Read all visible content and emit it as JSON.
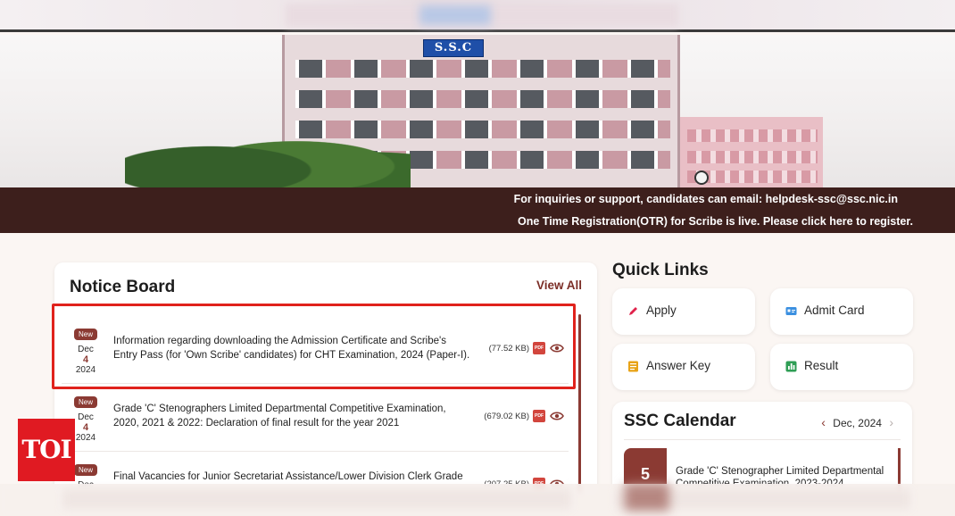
{
  "hero": {
    "building_sign": "S.S.C"
  },
  "info_banner": {
    "line1": "For inquiries or support, candidates can email: helpdesk-ssc@ssc.nic.in",
    "line2": "One Time Registration(OTR) for Scribe is live. Please click here to register."
  },
  "notice_board": {
    "title": "Notice Board",
    "view_all": "View All",
    "items": [
      {
        "badge": "New",
        "month": "Dec",
        "day": "4",
        "year": "2024",
        "text": "Information regarding downloading the Admission Certificate and Scribe's Entry Pass (for 'Own Scribe' candidates) for CHT Examination, 2024 (Paper-I).",
        "size": "(77.52 KB)",
        "pdf_label": "PDF",
        "highlighted": true
      },
      {
        "badge": "New",
        "month": "Dec",
        "day": "4",
        "year": "2024",
        "text": "Grade 'C' Stenographers Limited Departmental Competitive Examination, 2020, 2021 & 2022: Declaration of final result for the year 2021",
        "size": "(679.02 KB)",
        "pdf_label": "PDF",
        "highlighted": false
      },
      {
        "badge": "New",
        "month": "Dec",
        "day": "",
        "year": "",
        "text": "Final Vacancies for Junior Secretariat Assistance/Lower Division Clerk Grade",
        "size": "(207.25 KB)",
        "pdf_label": "PDF",
        "highlighted": false
      }
    ]
  },
  "quick_links": {
    "title": "Quick Links",
    "items": [
      {
        "label": "Apply",
        "icon": "pencil-icon",
        "color": "#e0224b"
      },
      {
        "label": "Admit Card",
        "icon": "id-card-icon",
        "color": "#3a8fe0"
      },
      {
        "label": "Answer Key",
        "icon": "list-icon",
        "color": "#e8a317"
      },
      {
        "label": "Result",
        "icon": "bar-chart-icon",
        "color": "#2f9e55"
      }
    ]
  },
  "calendar": {
    "title": "SSC Calendar",
    "month": "Dec, 2024",
    "event_day": "5",
    "event_text": "Grade 'C' Stenographer Limited Departmental Competitive Examination, 2023-2024"
  },
  "logo": {
    "text": "TOI"
  },
  "colors": {
    "brand_maroon": "#8b3a33",
    "banner_bg": "#3d1f1c",
    "highlight_red": "#e0221c"
  }
}
